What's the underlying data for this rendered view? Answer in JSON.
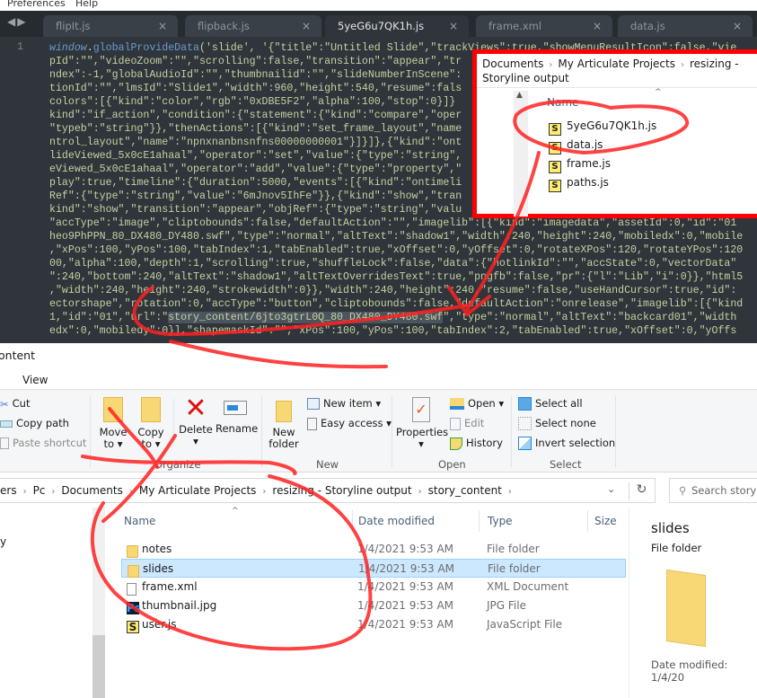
{
  "menubar": {
    "items": [
      "Preferences",
      "Help"
    ]
  },
  "editor": {
    "tabs": [
      {
        "label": "flipIt.js",
        "active": false
      },
      {
        "label": "flipback.js",
        "active": false
      },
      {
        "label": "5yeG6u7QK1h.js",
        "active": true
      },
      {
        "label": "frame.xml",
        "active": false
      },
      {
        "label": "data.js",
        "active": false
      }
    ],
    "close_glyph": "×",
    "line_number": "1",
    "first_line": {
      "kw": "window",
      "dot": ".",
      "fn": "globalProvideData",
      "rest": "('slide', '{\"title\":\"Untitled Slide\",\"trackViews\":true,\"showMenuResultIcon\":false,\"vie"
    },
    "lines": [
      "pId\":\"\",\"videoZoom\":\"\",\"scrolling\":false,\"transition\":\"appear\",\"tr",
      "ndex\":-1,\"globalAudioId\":\"\",\"thumbnailid\":\"\",\"slideNumberInScene\":",
      "tionId\":\"\",\"lmsId\":\"Slide1\",\"width\":960,\"height\":540,\"resume\":fals",
      "colors\":[{\"kind\":\"color\",\"rgb\":\"0xDBE5F2\",\"alpha\":100,\"stop\":0}]}",
      "kind\":\"if_action\",\"condition\":{\"statement\":{\"kind\":\"compare\",\"oper",
      "\"typeb\":\"string\"}},\"thenActions\":[{\"kind\":\"set_frame_layout\",\"name",
      "ntrol_layout\",\"name\":\"npnxnanbnsnfns00000000001\"}]}]},{\"kind\":\"ont",
      "lideViewed_5x0cE1ahaal\",\"operator\":\"set\",\"value\":{\"type\":\"string\",",
      "eViewed_5x0cE1ahaal\",\"operator\":\"add\",\"value\":{\"type\":\"property\",\"",
      "play\":true,\"timeline\":{\"duration\":5000,\"events\":[{\"kind\":\"ontimeli",
      "Ref\":{\"type\":\"string\",\"value\":\"6mJnov5IhFe\"}},{\"kind\":\"show\",\"tran",
      "kind\":\"show\",\"transition\":\"appear\",\"objRef\":{\"type\":\"string\",\"valu",
      "\"accType\":\"image\",\"cliptobounds\":false,\"defaultAction\":\"\",\"imagelib\":[{\"kind\":\"imagedata\",\"assetId\":0,\"id\":\"01",
      "heo9PhPPN_80_DX480_DY480.swf\",\"type\":\"normal\",\"altText\":\"shadow1\",\"width\":240,\"height\":240,\"mobiledx\":0,\"mobile",
      ",\"xPos\":100,\"yPos\":100,\"tabIndex\":1,\"tabEnabled\":true,\"xOffset\":0,\"yOffset\":0,\"rotateXPos\":120,\"rotateYPos\":120",
      "00,\"alpha\":100,\"depth\":1,\"scrolling\":true,\"shuffleLock\":false,\"data\":{\"hotlinkId\":\"\",\"accState\":0,\"vectorData\"",
      "\":240,\"bottom\":240,\"altText\":\"shadow1\",\"altTextOverridesText\":true,\"pngfb\":false,\"pr\":{\"l\":\"Lib\",\"i\":0}},\"html5",
      ",\"width\":240,\"height\":240,\"strokewidth\":0}},\"width\":240,\"height\":240,\"resume\":false,\"useHandCursor\":true,\"id\":",
      "ectorshape\",\"rotation\":0,\"accType\":\"button\",\"cliptobounds\":false,\"defaultAction\":\"onrelease\",\"imagelib\":[{\"kind"
    ],
    "hl_line": {
      "pre": "1,\"id\":\"01\",\"url\":\"",
      "hl": "story_content/6jto3gtrL0Q_80_DX480_DY480.swf",
      "post": "\",\"type\":\"normal\",\"altText\":\"backcard01\",\"width"
    },
    "last_line": "edx\":0,\"mobiledy\":0}],\"shapemaskId\":\"\",\"xPos\":100,\"yPos\":100,\"tabIndex\":2,\"tabEnabled\":true,\"xOffset\":0,\"yOffs"
  },
  "popup": {
    "breadcrumb": [
      "Documents",
      "My Articulate Projects",
      "resizing - Storyline output"
    ],
    "column_name": "Name",
    "files": [
      "5yeG6u7QK1h.js",
      "data.js",
      "frame.js",
      "paths.js"
    ]
  },
  "explorer": {
    "title": "ontent",
    "view_tab": "View",
    "clipboard": {
      "cut": "Cut",
      "copy_path": "Copy path",
      "paste_shortcut": "Paste shortcut"
    },
    "organize": {
      "move_to": "Move to",
      "copy_to": "Copy to",
      "delete": "Delete",
      "rename": "Rename",
      "label": "Organize"
    },
    "new": {
      "new_folder": "New folder",
      "new_item": "New item",
      "easy_access": "Easy access",
      "label": "New"
    },
    "open": {
      "properties": "Properties",
      "open": "Open",
      "edit": "Edit",
      "history": "History",
      "label": "Open"
    },
    "select": {
      "select_all": "Select all",
      "select_none": "Select none",
      "invert": "Invert selection",
      "label": "Select"
    },
    "address": [
      "ers",
      "Pc",
      "Documents",
      "My Articulate Projects",
      "resizing - Storyline output",
      "story_content"
    ],
    "search_placeholder": "Search story",
    "nav_partial": "y",
    "columns": {
      "name": "Name",
      "date": "Date modified",
      "type": "Type",
      "size": "Size"
    },
    "files": [
      {
        "name": "notes",
        "date": "1/4/2021 9:53 AM",
        "type": "File folder",
        "icon": "folder-icon"
      },
      {
        "name": "slides",
        "date": "1/4/2021 9:53 AM",
        "type": "File folder",
        "icon": "folder-icon",
        "selected": true
      },
      {
        "name": "frame.xml",
        "date": "1/4/2021 9:53 AM",
        "type": "XML Document",
        "icon": "document-icon"
      },
      {
        "name": "thumbnail.jpg",
        "date": "1/4/2021 9:53 AM",
        "type": "JPG File",
        "icon": "photoshop-icon"
      },
      {
        "name": "user.js",
        "date": "1/4/2021 9:53 AM",
        "type": "JavaScript File",
        "icon": "js-file-icon"
      }
    ],
    "preview": {
      "name": "slides",
      "type": "File folder",
      "date_label": "Date modified:",
      "date_value": "1/4/20"
    }
  },
  "colors": {
    "annotation": "#ff0000",
    "selection": "#cce8ff",
    "editor_bg": "#2f353b"
  }
}
